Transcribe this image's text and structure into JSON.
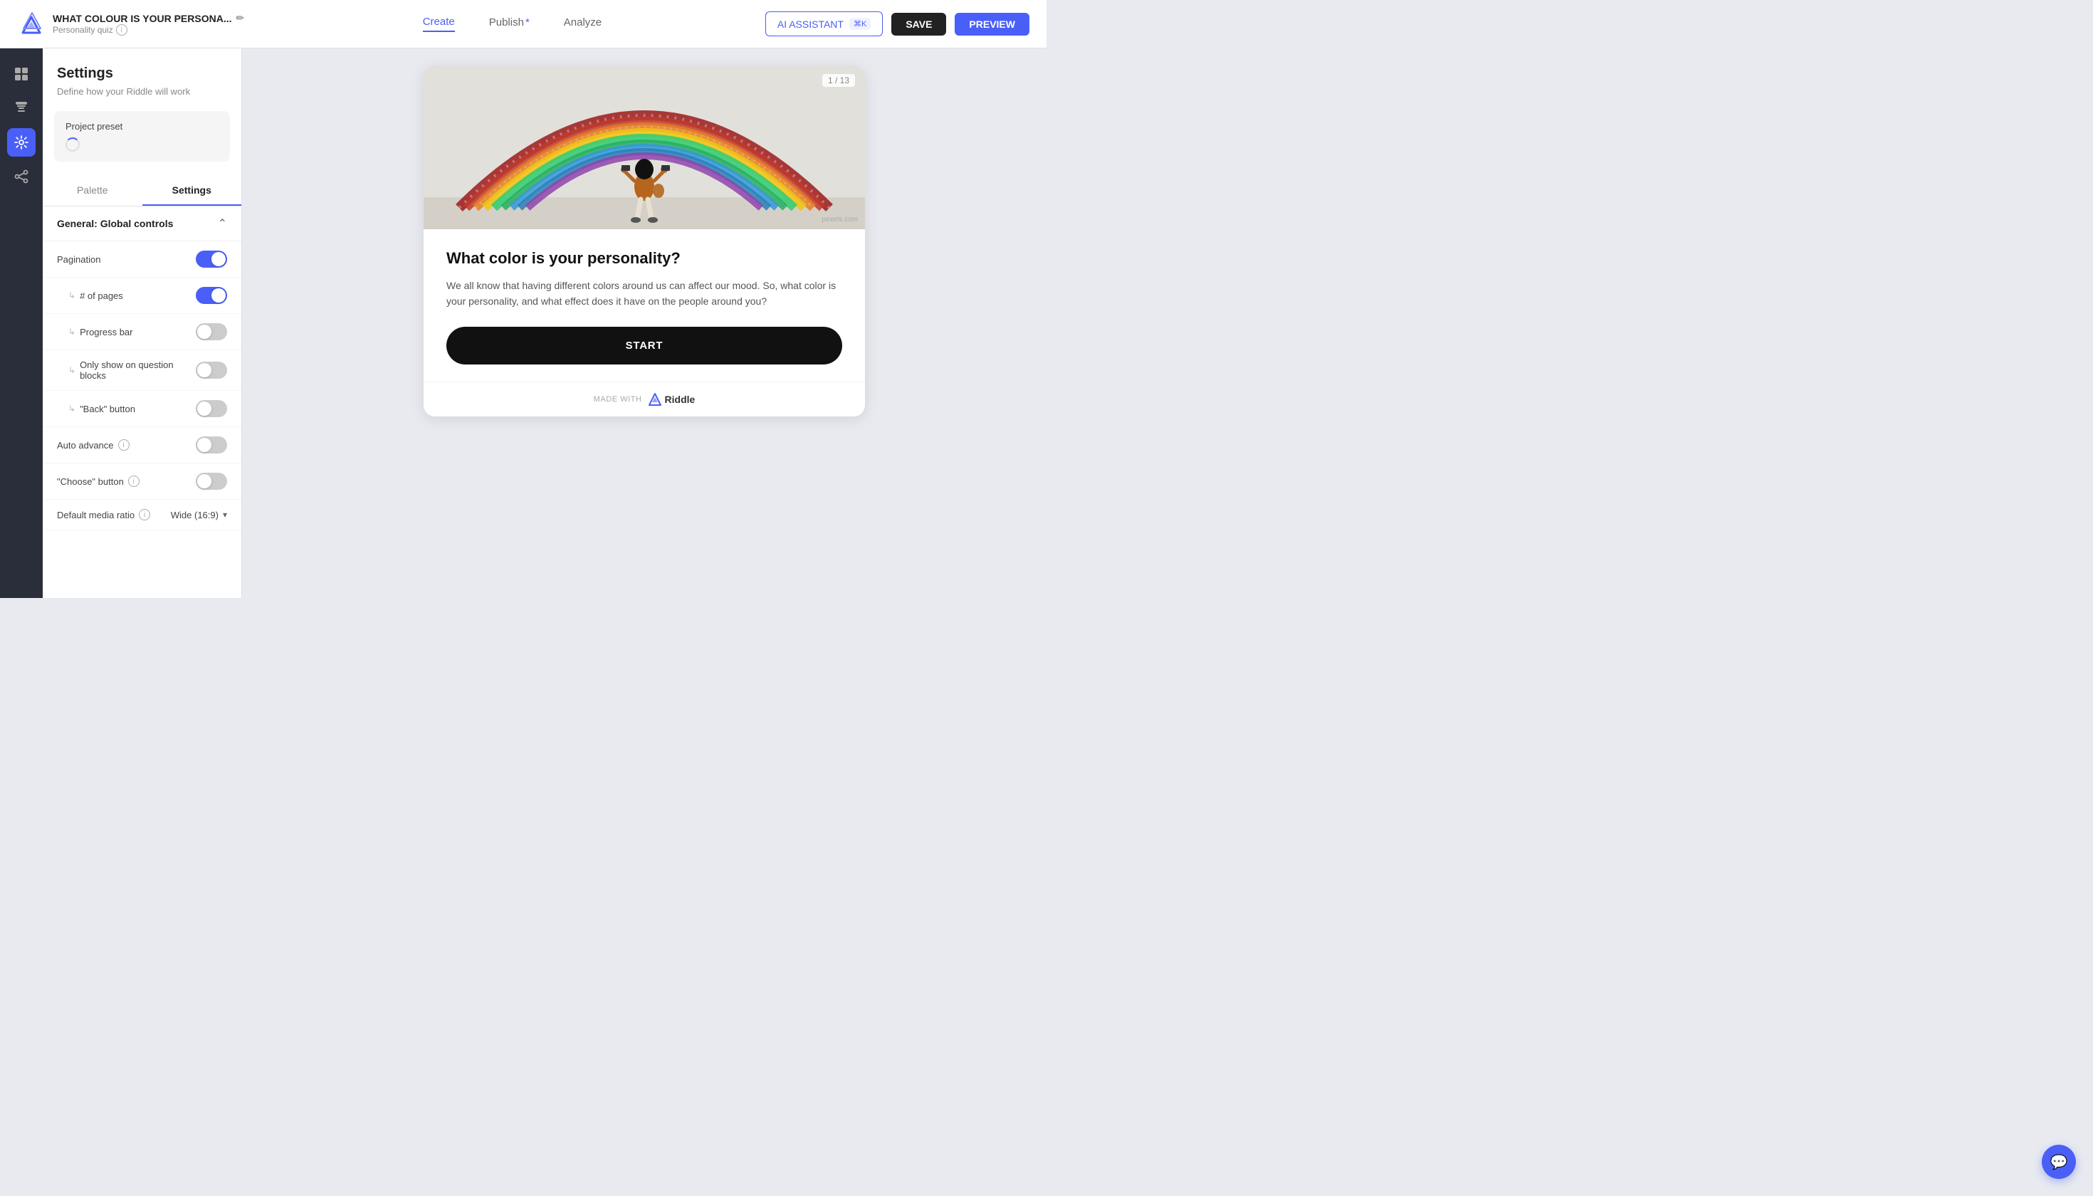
{
  "topnav": {
    "quiz_title": "WHAT COLOUR IS YOUR PERSONA...",
    "quiz_subtitle": "Personality quiz",
    "nav_items": [
      {
        "label": "Create",
        "active": true
      },
      {
        "label": "Publish",
        "active": false,
        "has_asterisk": true
      },
      {
        "label": "Analyze",
        "active": false
      }
    ],
    "ai_button_label": "AI ASSISTANT",
    "ai_shortcut": "⌘K",
    "save_label": "SAVE",
    "preview_label": "PREVIEW"
  },
  "icon_sidebar": {
    "icons": [
      {
        "name": "grid-icon",
        "symbol": "⊞",
        "active": true
      },
      {
        "name": "bookmark-icon",
        "symbol": "🏷",
        "active": false
      },
      {
        "name": "gear-icon",
        "symbol": "⚙",
        "active": true
      },
      {
        "name": "share-icon",
        "symbol": "⬡",
        "active": false
      }
    ]
  },
  "settings_panel": {
    "title": "Settings",
    "description": "Define how your Riddle will work",
    "preset_label": "Project preset",
    "tabs": [
      {
        "label": "Palette",
        "active": false
      },
      {
        "label": "Settings",
        "active": true
      }
    ],
    "section_title": "General: Global controls",
    "settings": [
      {
        "label": "Pagination",
        "indented": false,
        "toggle": "on",
        "has_info": false
      },
      {
        "label": "# of pages",
        "indented": true,
        "toggle": "on",
        "has_info": false
      },
      {
        "label": "Progress bar",
        "indented": true,
        "toggle": "off",
        "has_info": false
      },
      {
        "label": "Only show on question blocks",
        "indented": true,
        "toggle": "off",
        "has_info": false
      },
      {
        "label": "\"Back\" button",
        "indented": true,
        "toggle": "off",
        "has_info": false
      },
      {
        "label": "Auto advance",
        "indented": false,
        "toggle": "off",
        "has_info": true
      },
      {
        "label": "\"Choose\" button",
        "indented": false,
        "toggle": "off",
        "has_info": true
      }
    ],
    "media_ratio_label": "Default media ratio",
    "media_ratio_value": "Wide (16:9)"
  },
  "preview": {
    "page_counter": "1 / 13",
    "photo_credit": "pexels.com",
    "quiz_title": "What color is your personality?",
    "quiz_description": "We all know that having different colors around us can affect our mood. So, what color is your personality, and what effect does it have on the people around you?",
    "start_button": "START",
    "made_with": "MADE WITH",
    "riddle_label": "Riddle"
  },
  "chat_bubble": {
    "label": "chat"
  }
}
